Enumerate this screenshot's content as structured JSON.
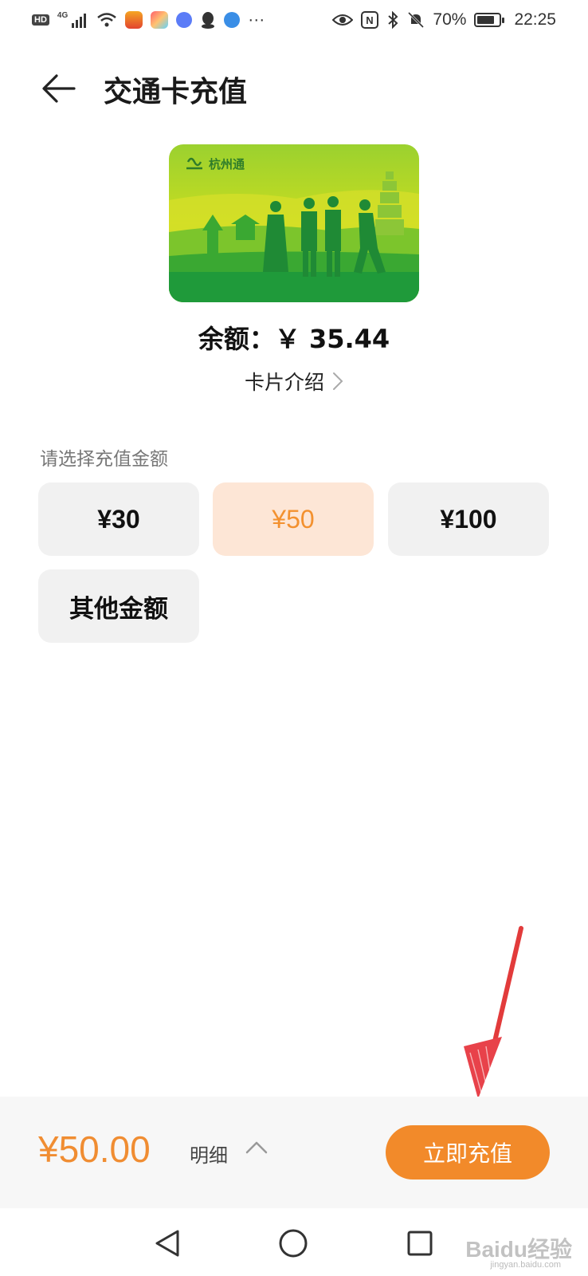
{
  "status_bar": {
    "network_badge": "HD",
    "network_type": "4G",
    "battery_percent": "70%",
    "time": "22:25",
    "more_dots": "···",
    "nfc_label": "N"
  },
  "header": {
    "title": "交通卡充值"
  },
  "card": {
    "brand": "杭州通",
    "balance_text": "余额：￥ 35.44",
    "intro_label": "卡片介绍"
  },
  "amounts": {
    "label": "请选择充值金额",
    "options": [
      "¥30",
      "¥50",
      "¥100",
      "其他金额"
    ],
    "selected_index": 1
  },
  "bottom": {
    "total": "¥50.00",
    "detail_label": "明细",
    "recharge_label": "立即充值"
  },
  "watermark": {
    "text": "Baidu经验",
    "url": "jingyan.baidu.com"
  },
  "colors": {
    "accent": "#f28a2a",
    "selected_bg": "#fde6d6",
    "card_green": "#6cc62e"
  }
}
